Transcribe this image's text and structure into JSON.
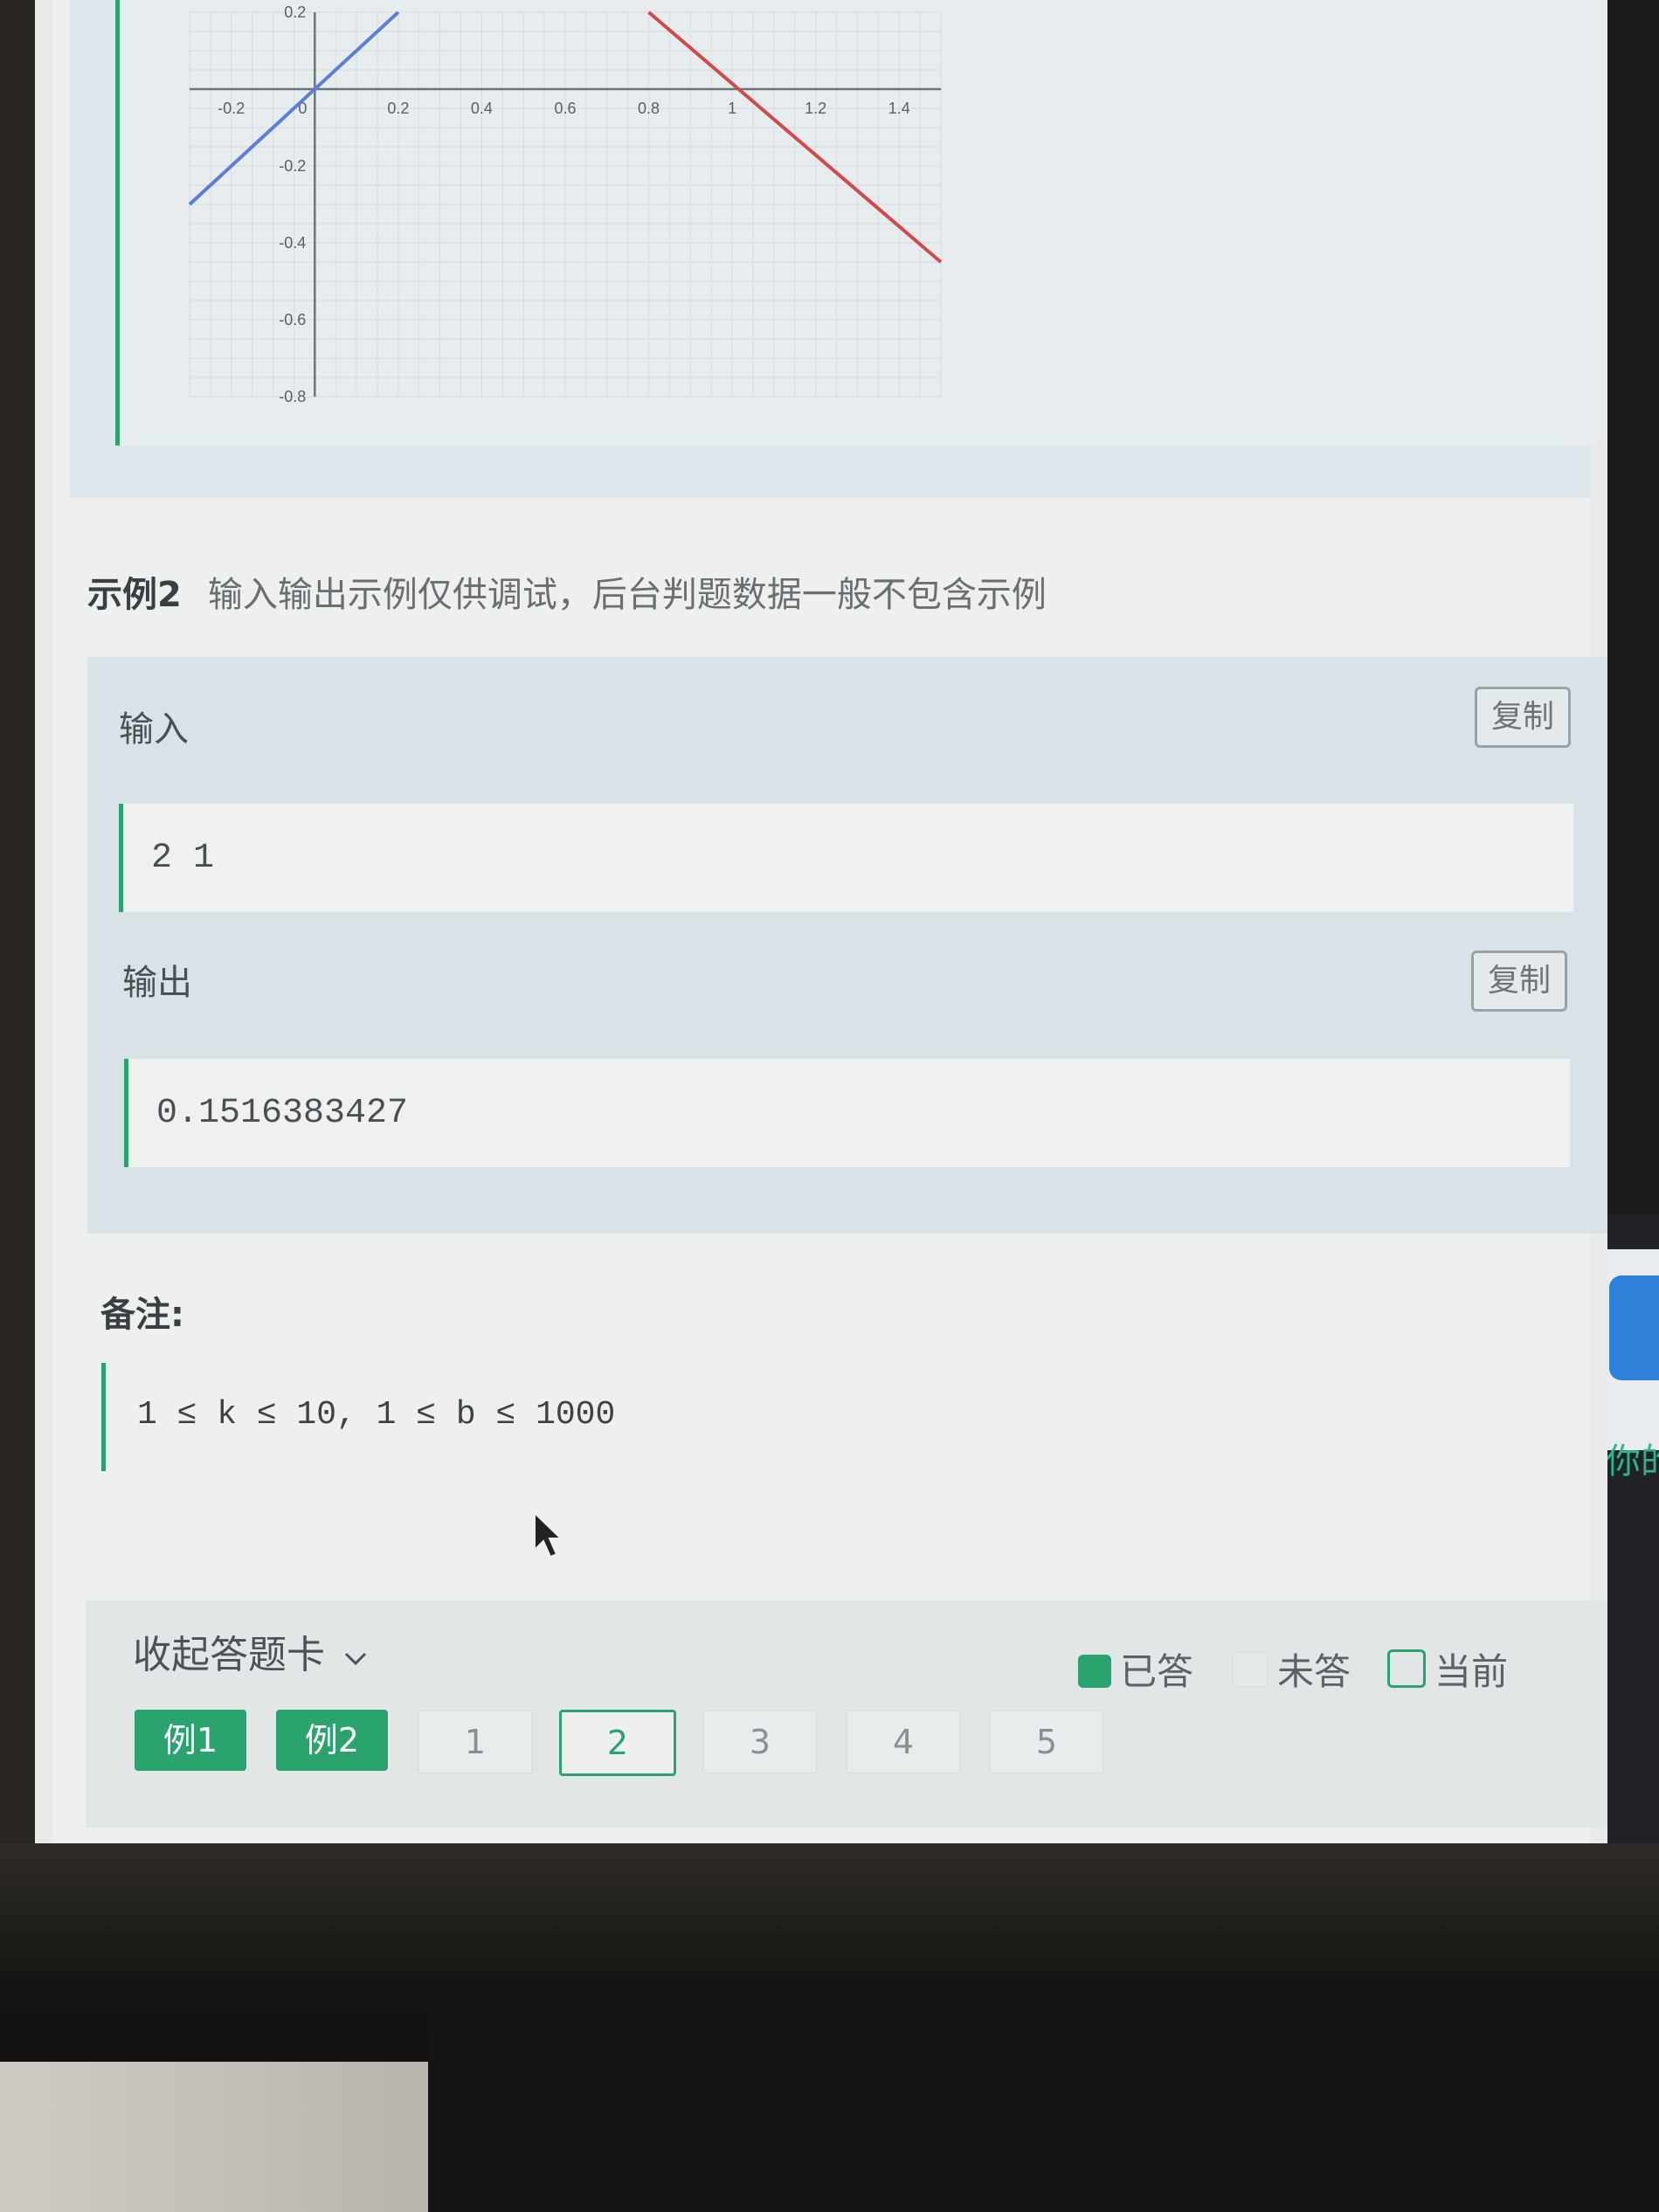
{
  "chart": {
    "x_ticks": [
      "-0.2",
      "0",
      "0.2",
      "0.4",
      "0.6",
      "0.8",
      "1",
      "1.2",
      "1.4"
    ],
    "y_ticks": [
      "0.2",
      "-0.2",
      "-0.4",
      "-0.6",
      "-0.8"
    ],
    "colors": {
      "blue_line": "#5b7fd6",
      "red_line": "#d04a4a",
      "grid": "#c9cfd3",
      "axis": "#6d7479"
    }
  },
  "chart_data": {
    "type": "line",
    "xlim": [
      -0.3,
      1.5
    ],
    "ylim": [
      -0.8,
      0.2
    ],
    "grid": true,
    "series": [
      {
        "x": [
          -0.3,
          0.2
        ],
        "y": [
          -0.3,
          0.2
        ]
      },
      {
        "x": [
          0.8,
          1.5
        ],
        "y": [
          0.2,
          -0.45
        ]
      }
    ]
  },
  "example": {
    "title": "示例2",
    "subtitle": "输入输出示例仅供调试，后台判题数据一般不包含示例"
  },
  "io": {
    "input_label": "输入",
    "input_copy": "复制",
    "input_value": "2 1",
    "output_label": "输出",
    "output_copy": "复制",
    "output_value": "0.1516383427"
  },
  "note": {
    "title": "备注:",
    "text": "1 ≤ k ≤ 10, 1 ≤ b ≤ 1000"
  },
  "answer_card": {
    "collapse_label": "收起答题卡",
    "legend": {
      "answered": "已答",
      "unanswered": "未答",
      "current": "当前"
    },
    "buttons": [
      "例1",
      "例2",
      "1",
      "2",
      "3",
      "4",
      "5"
    ]
  },
  "side_panel": {
    "hint_text": "你的"
  },
  "colors": {
    "accent": "#2aa36f",
    "blue": "#2f80d9"
  }
}
